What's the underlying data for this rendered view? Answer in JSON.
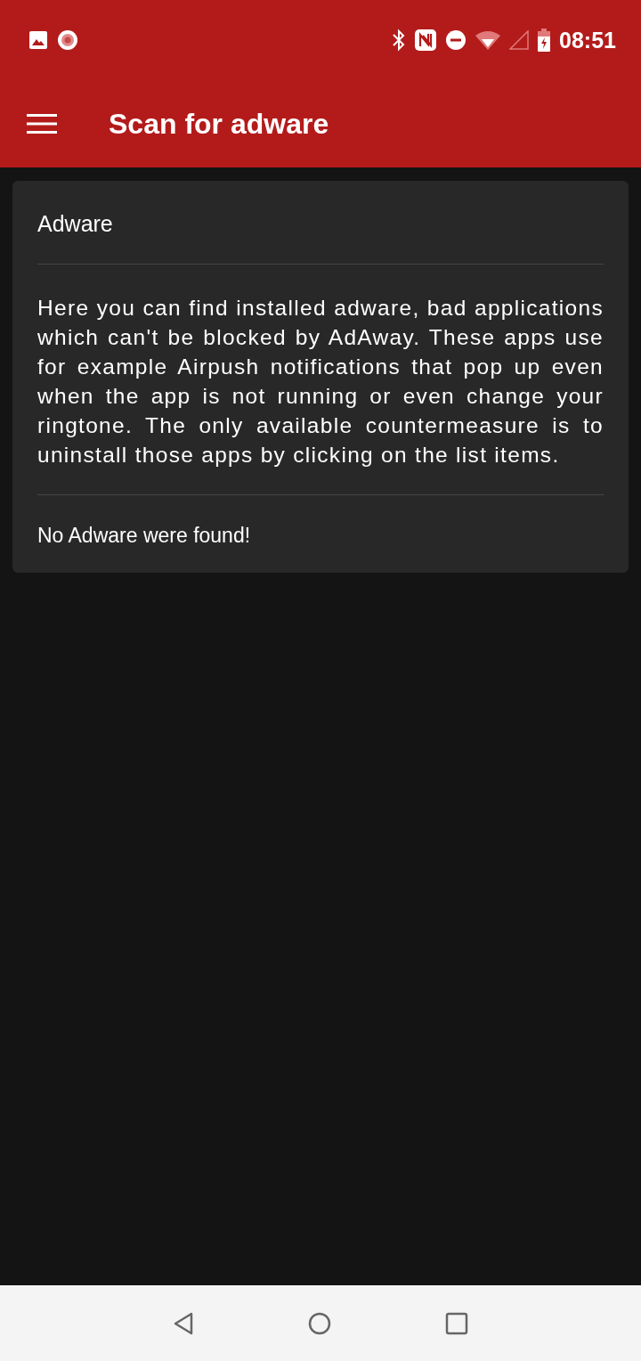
{
  "status_bar": {
    "time": "08:51"
  },
  "toolbar": {
    "title": "Scan for adware"
  },
  "card": {
    "title": "Adware",
    "description": "Here you can find installed adware, bad applications which can't be blocked by AdAway. These apps use for example Airpush notifications that pop up even when the app is not running or even change your ringtone. The only available countermeasure is to uninstall those apps by clicking on the list items.",
    "result": "No Adware were found!"
  }
}
